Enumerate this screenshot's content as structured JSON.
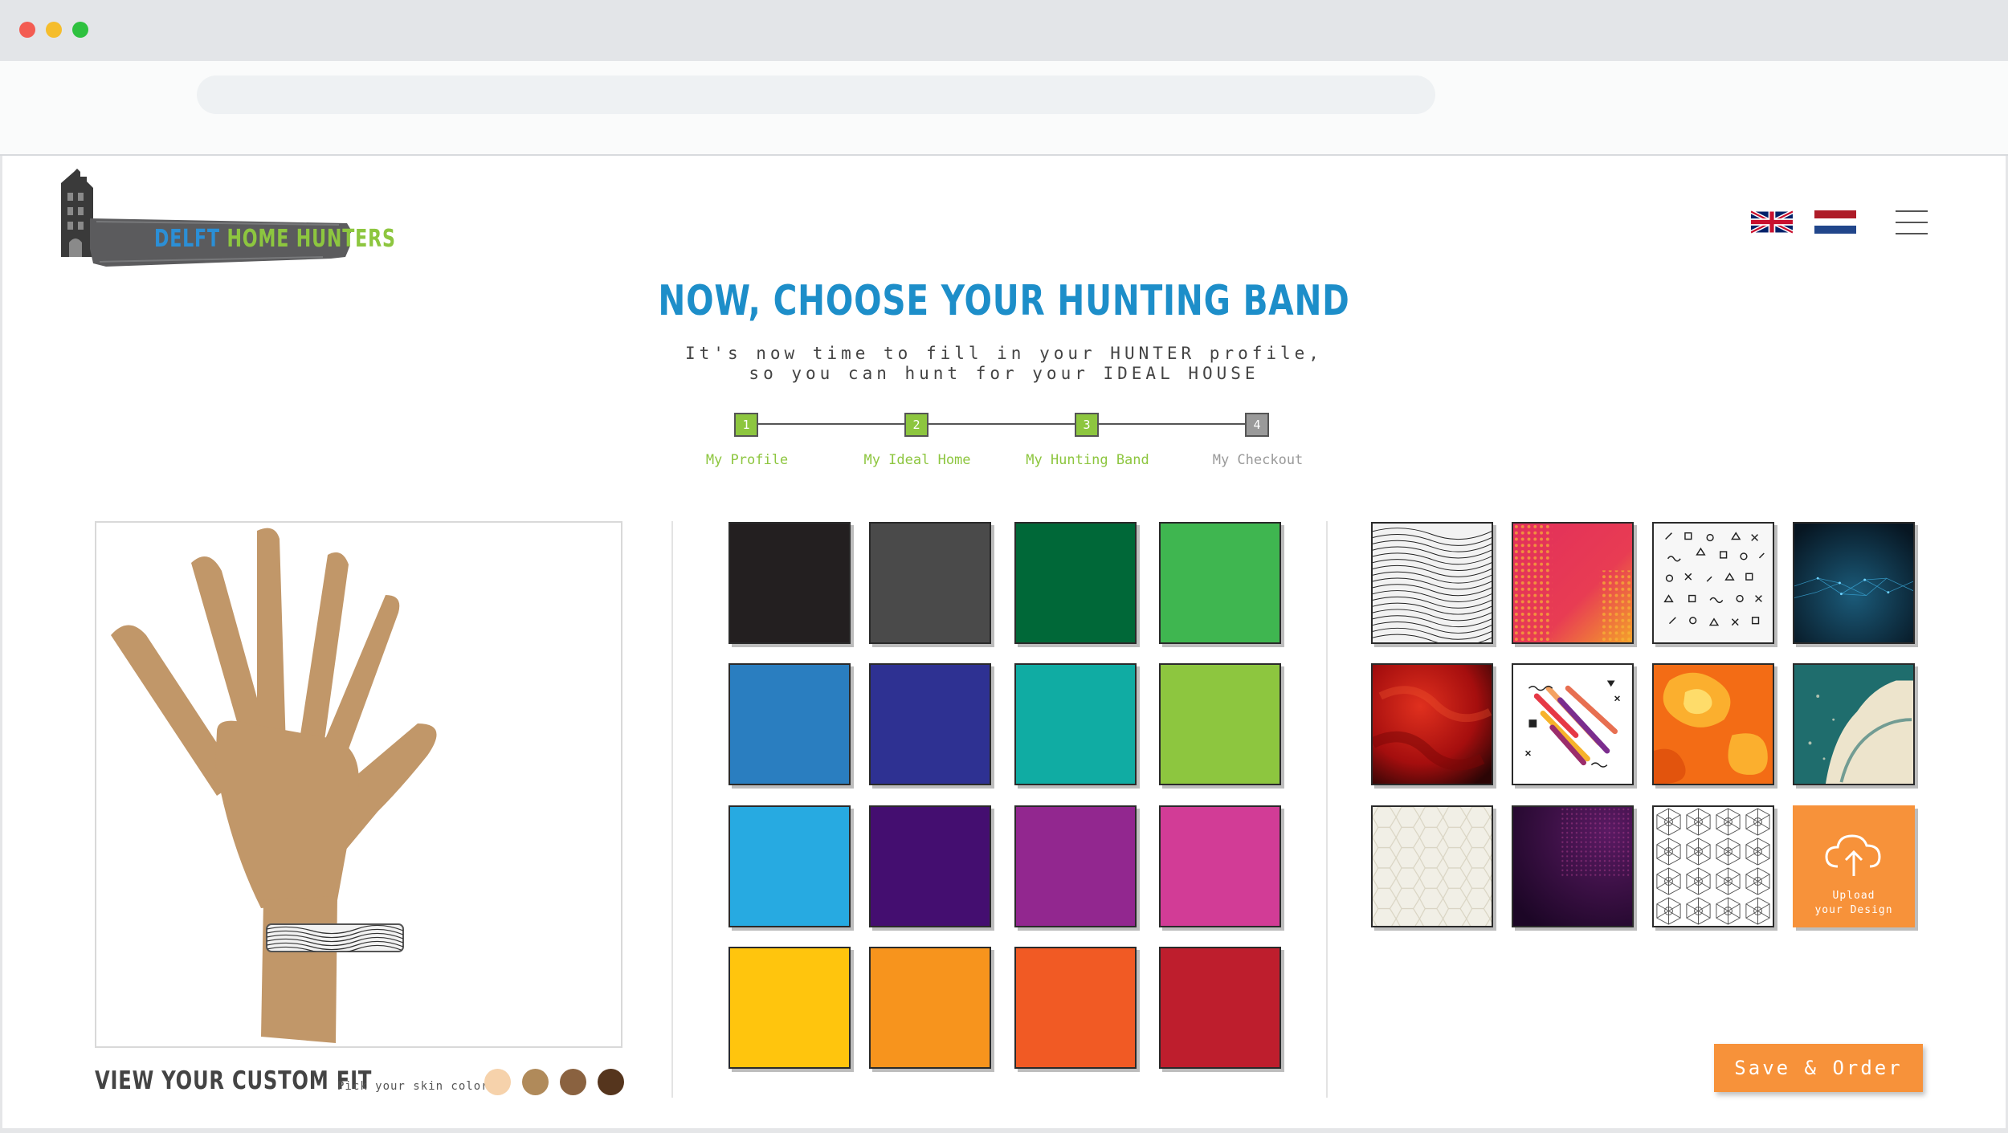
{
  "header": {
    "logo": {
      "word1": "DELFT",
      "word2": "HOME HUNTERS"
    },
    "languages": [
      "en",
      "nl"
    ]
  },
  "title": "NOW, CHOOSE YOUR HUNTING BAND",
  "subtitle": {
    "line1": "It's now time to fill in your HUNTER profile,",
    "line2": "so you can hunt for your IDEAL HOUSE"
  },
  "steps": [
    {
      "number": "1",
      "label": "My Profile",
      "status": "done"
    },
    {
      "number": "2",
      "label": "My Ideal Home",
      "status": "done"
    },
    {
      "number": "3",
      "label": "My Hunting Band",
      "status": "done"
    },
    {
      "number": "4",
      "label": "My Checkout",
      "status": "todo"
    }
  ],
  "preview": {
    "title": "VIEW YOUR CUSTOM FIT",
    "skin_label": "Pick your skin color",
    "skin_colors": [
      "#f6d2ab",
      "#b08a5a",
      "#8a6240",
      "#55351d"
    ],
    "hand_color": "#c19769",
    "band_pattern": "wavy-lines"
  },
  "colors": [
    "#231f20",
    "#4a4a4a",
    "#006838",
    "#3fb650",
    "#2a7ec0",
    "#2e3192",
    "#10aca3",
    "#8dc63f",
    "#27aae1",
    "#440e70",
    "#92278f",
    "#d23c96",
    "#ffc50d",
    "#f7941d",
    "#f15a24",
    "#be1e2d"
  ],
  "patterns": [
    "wavy-lines",
    "pink-halftone",
    "geometric-shapes",
    "blue-network",
    "red-smoke",
    "abstract-streaks",
    "orange-camo",
    "teal-grunge",
    "hexagon-light",
    "purple-dots",
    "geometric-mosaic"
  ],
  "upload": {
    "line1": "Upload",
    "line2": "your Design",
    "icon": "cloud-upload-icon"
  },
  "save_order_label": "Save & Order"
}
